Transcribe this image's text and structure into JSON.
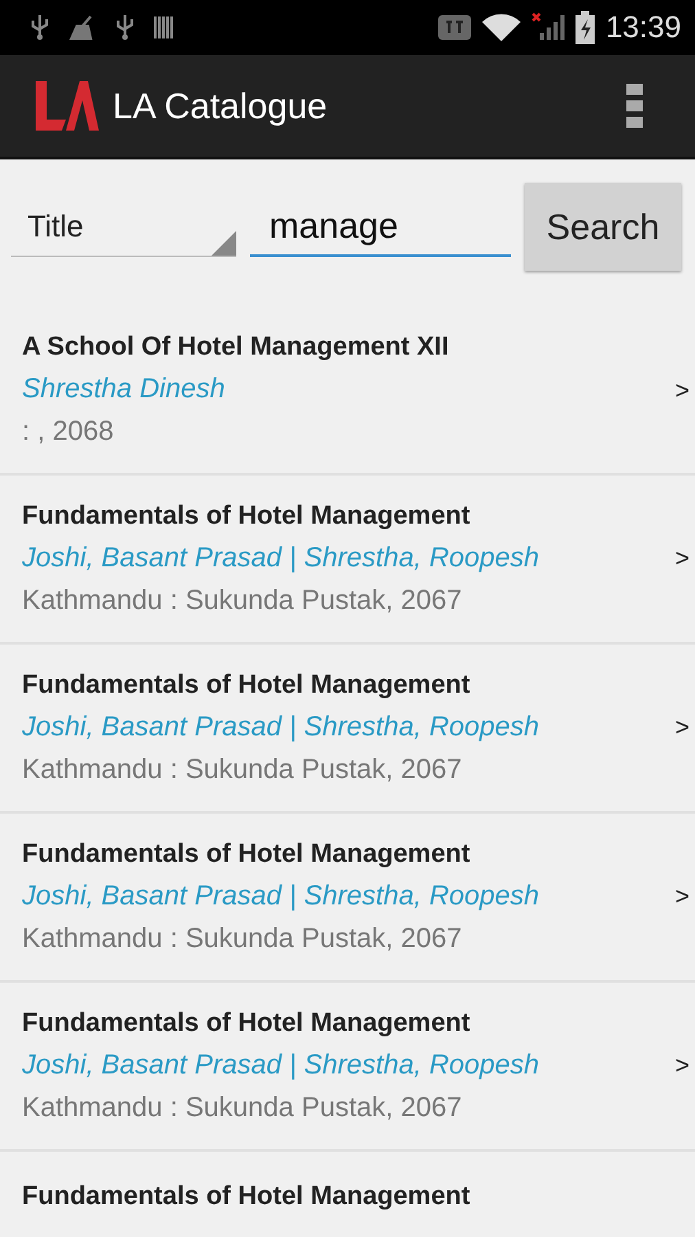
{
  "status_bar": {
    "time": "13:39"
  },
  "app_bar": {
    "title": "LA Catalogue"
  },
  "search": {
    "field_type": "Title",
    "query": "manage",
    "button": "Search"
  },
  "results": [
    {
      "title": "A School Of Hotel Management XII",
      "authors": "Shrestha  Dinesh",
      "publisher": ": , 2068",
      "chevron": ">"
    },
    {
      "title": "Fundamentals of Hotel Management",
      "authors": "Joshi, Basant Prasad | Shrestha, Roopesh",
      "publisher": "Kathmandu : Sukunda Pustak, 2067",
      "chevron": ">"
    },
    {
      "title": "Fundamentals of Hotel Management",
      "authors": "Joshi, Basant Prasad | Shrestha, Roopesh",
      "publisher": "Kathmandu : Sukunda Pustak, 2067",
      "chevron": ">"
    },
    {
      "title": "Fundamentals of Hotel Management",
      "authors": "Joshi, Basant Prasad | Shrestha, Roopesh",
      "publisher": "Kathmandu : Sukunda Pustak, 2067",
      "chevron": ">"
    },
    {
      "title": "Fundamentals of Hotel Management",
      "authors": "Joshi, Basant Prasad | Shrestha, Roopesh",
      "publisher": "Kathmandu : Sukunda Pustak, 2067",
      "chevron": ">"
    },
    {
      "title": "Fundamentals of Hotel Management"
    }
  ]
}
